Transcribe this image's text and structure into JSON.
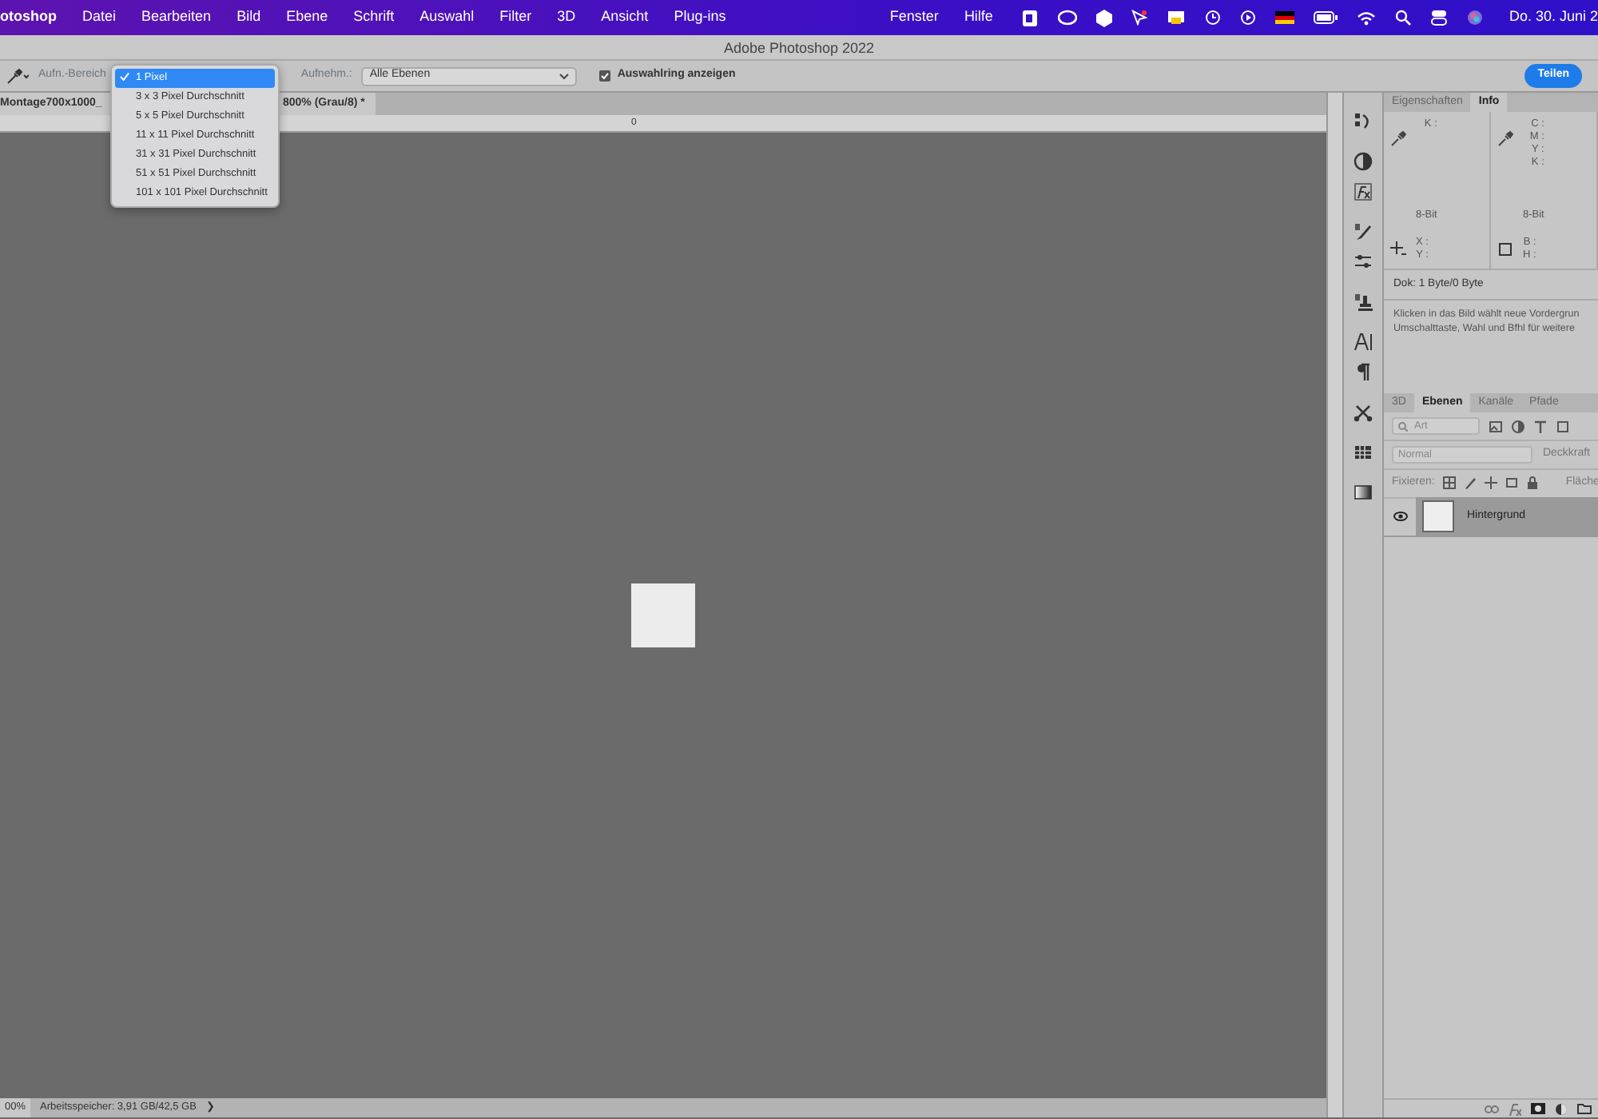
{
  "menubar": {
    "app_name": "otoshop",
    "menus": [
      "Datei",
      "Bearbeiten",
      "Bild",
      "Ebene",
      "Schrift",
      "Auswahl",
      "Filter",
      "3D",
      "Ansicht",
      "Plug-ins"
    ],
    "right_menus": [
      "Fenster",
      "Hilfe"
    ],
    "clock": "Do. 30. Juni 2"
  },
  "window": {
    "title": "Adobe Photoshop 2022"
  },
  "options_bar": {
    "sample_size_label": "Aufn.-Bereich",
    "sample_size_options": [
      {
        "label": "1 Pixel",
        "selected": true
      },
      {
        "label": "3 x 3 Pixel Durchschnitt",
        "selected": false
      },
      {
        "label": "5 x 5 Pixel Durchschnitt",
        "selected": false
      },
      {
        "label": "11 x 11 Pixel Durchschnitt",
        "selected": false
      },
      {
        "label": "31 x 31 Pixel Durchschnitt",
        "selected": false
      },
      {
        "label": "51 x 51 Pixel Durchschnitt",
        "selected": false
      },
      {
        "label": "101 x 101 Pixel Durchschnitt",
        "selected": false
      }
    ],
    "sample_label": "Aufnehm.:",
    "sample_value": "Alle Ebenen",
    "show_ring": {
      "label": "Auswahlring anzeigen",
      "checked": true
    },
    "share_button": "Teilen"
  },
  "document_tab": {
    "title_start": "Montage700x1000_",
    "title_end": "800% (Grau/8) *"
  },
  "ruler": {
    "mark": "0"
  },
  "status_bar": {
    "zoom": "00%",
    "memory": "Arbeitsspeicher: 3,91 GB/42,5 GB",
    "more": "❯"
  },
  "info_panel": {
    "tabs": [
      {
        "label": "Eigenschaften",
        "selected": false
      },
      {
        "label": "Info",
        "selected": true
      }
    ],
    "left_labels": [
      "K :"
    ],
    "left_depth": "8-Bit",
    "right_labels": [
      "C :",
      "M :",
      "Y :",
      "K :"
    ],
    "right_depth": "8-Bit",
    "position_labels": [
      "X :",
      "Y :"
    ],
    "size_labels": [
      "B :",
      "H :"
    ],
    "document": "Dok: 1 Byte/0 Byte",
    "hint_lines": [
      "Klicken in das Bild wählt neue Vordergrun",
      "Umschalttaste, Wahl und Bfhl für weitere"
    ]
  },
  "layers_panel": {
    "tabs": [
      {
        "label": "3D",
        "selected": false
      },
      {
        "label": "Ebenen",
        "selected": true
      },
      {
        "label": "Kanäle",
        "selected": false
      },
      {
        "label": "Pfade",
        "selected": false
      }
    ],
    "filter_placeholder": "Art",
    "blend_mode": "Normal",
    "opacity_label": "Deckkraft",
    "lock_label": "Fixieren:",
    "fill_label": "Fläche",
    "layers": [
      {
        "name": "Hintergrund",
        "visible": true,
        "selected": true
      }
    ]
  }
}
